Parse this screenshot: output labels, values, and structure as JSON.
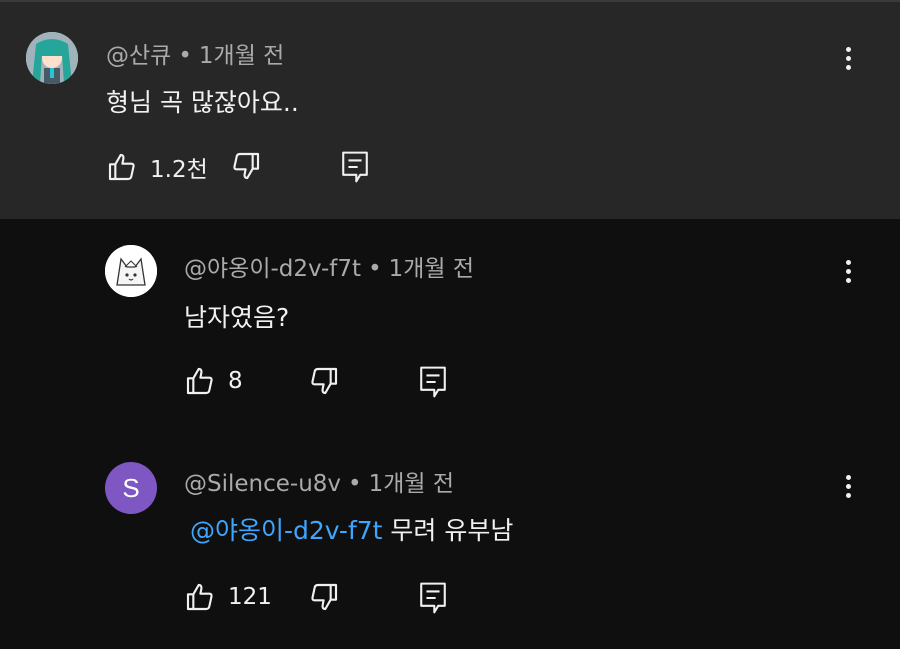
{
  "comments": [
    {
      "handle": "@산큐",
      "separator": "•",
      "time": "1개월 전",
      "text": "형님 곡 많잖아요..",
      "likes": "1.2천",
      "avatar_icon": "miku-avatar"
    },
    {
      "handle": "@야옹이-d2v-f7t",
      "separator": "•",
      "time": "1개월 전",
      "text": "남자였음?",
      "likes": "8",
      "avatar_icon": "cat-avatar"
    },
    {
      "handle": "@Silence-u8v",
      "separator": "•",
      "time": "1개월 전",
      "mention": "@야옹이-d2v-f7t",
      "text": "무려 유부남",
      "likes": "121",
      "avatar_letter": "S",
      "avatar_color": "#7e57c2"
    }
  ],
  "colors": {
    "background": "#0f0f0f",
    "highlight_background": "#272727",
    "mention": "#3ea6ff",
    "meta_text": "#aaaaaa"
  },
  "icons": {
    "like": "thumb-up-icon",
    "dislike": "thumb-down-icon",
    "reply": "reply-icon",
    "menu": "more-vert-icon"
  }
}
